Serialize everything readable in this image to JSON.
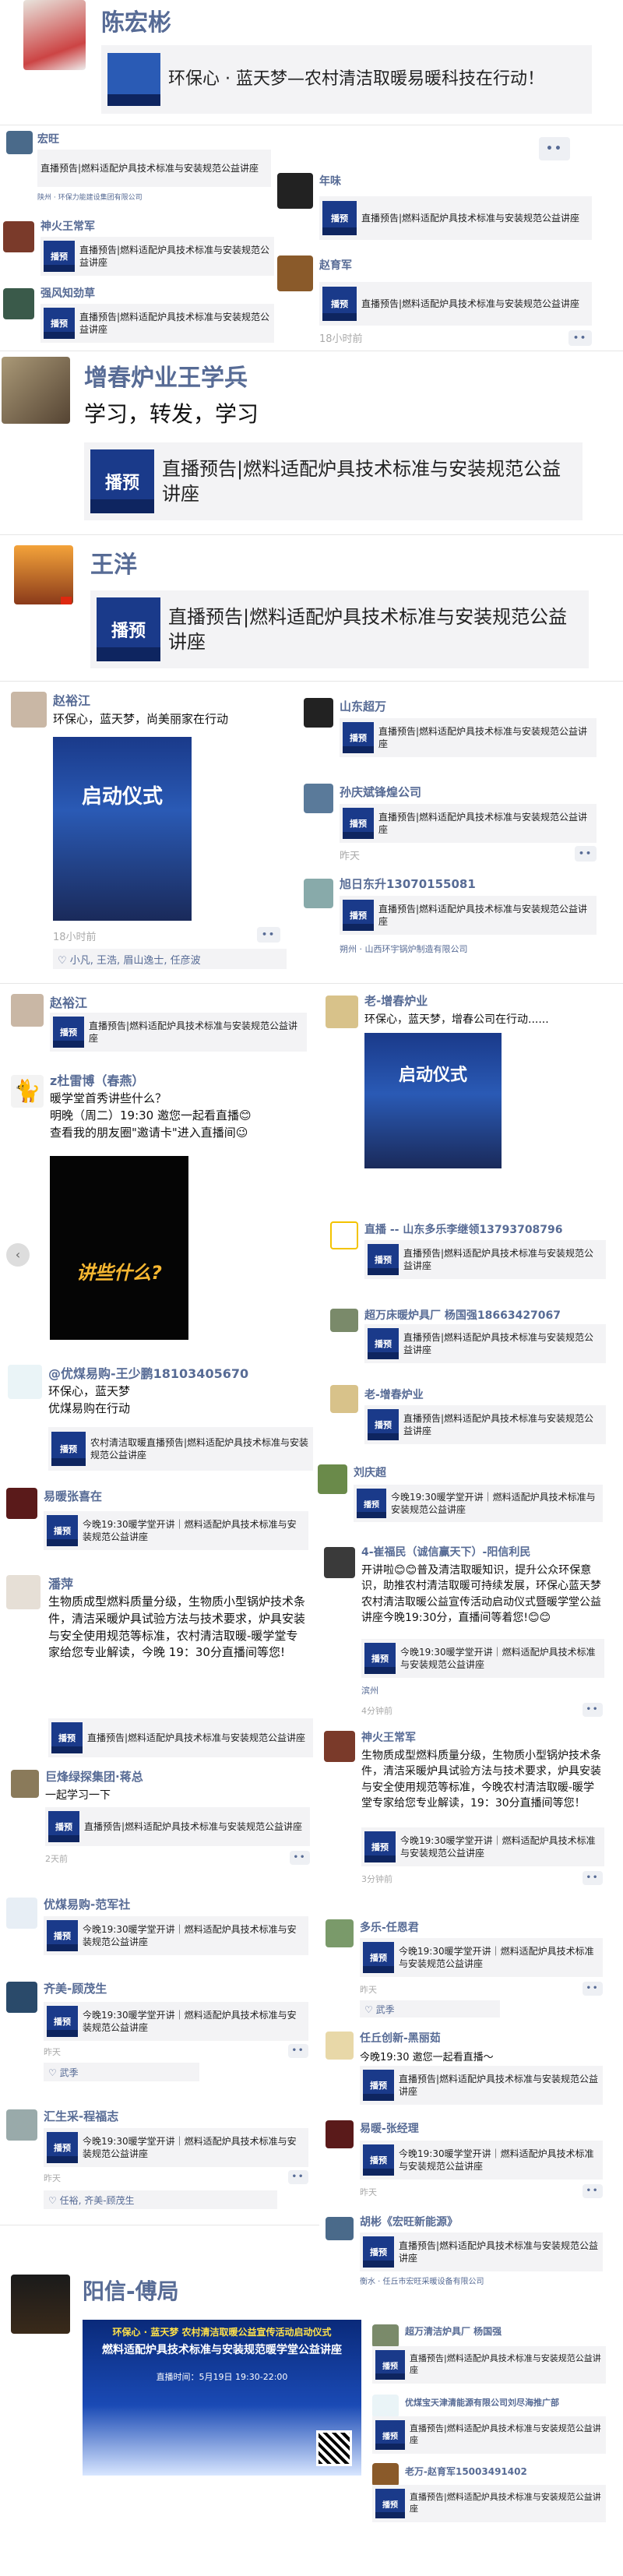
{
  "article_title": "环保心 · 蓝天梦—农村清洁取暖易暖科技在行动！",
  "share_title_a": "直播预告|燃料适配炉具技术标准与安装规范公益讲座",
  "share_title_b": "今晚19:30暖学堂开讲｜燃料适配炉具技术标准与安装规范公益讲座",
  "share_title_c": "农村清洁取暖直播预告|燃料适配炉具技术标准与安装规范公益讲座",
  "thumb_text": "播预",
  "sections": {
    "s1": {
      "name": "陈宏彬"
    },
    "s2": {
      "left_names": [
        "宏旺",
        "神火王常军",
        "强风知劲草"
      ],
      "left_source": "陕州 · 环保力能建设集团有限公司",
      "right_names": [
        "年味",
        "赵育军"
      ],
      "time": "18小时前"
    },
    "s3": {
      "name": "增春炉业王学兵",
      "text": "学习，转发，学习"
    },
    "s4": {
      "name": "王洋"
    },
    "s5": {
      "left_name": "赵裕江",
      "left_text": "环保心，蓝天梦，尚美丽家在行动",
      "poster_text": "启动仪式",
      "left_time": "18小时前",
      "likes": "小凡, 王浩, 眉山逸士, 任彦波",
      "right_names": [
        "山东超万",
        "孙庆斌锋煌公司",
        "旭日东升13070155081"
      ],
      "right_time": "昨天",
      "right_source": "朔州 · 山西环宇锅炉制造有限公司"
    },
    "s6": {
      "left": {
        "name1": "赵裕江",
        "name2": "z杜雷博（春燕）",
        "text2": "暖学堂首秀讲些什么？\n明晚（周二）19:30 邀您一起看直播😊\n查看我的朋友圈\"邀请卡\"进入直播间😉",
        "video_text": "讲些什么?",
        "name3": "@优煤易购-王少鹏18103405670",
        "text3": "环保心，蓝天梦\n优煤易购在行动",
        "name4": "易暖张喜在",
        "name5": "潘萍",
        "text5": "生物质成型燃料质量分级，生物质小型锅炉技术条件，清洁采暖炉具试验方法与技术要求，炉具安装与安全使用规范等标准，农村清洁取暖-暖学堂专家给您专业解读，今晚 19：30分直播间等您!",
        "name6": "巨烽绿探集团·蒋总",
        "text6": "一起学习一下",
        "time6": "2天前",
        "name7": "优煤易购-范军社",
        "name8": "齐美-顾茂生",
        "time8": "昨天",
        "like8": "武季",
        "name9": "汇生采-程福志",
        "time9": "昨天",
        "like9": "任裕, 齐美-顾茂生"
      },
      "right": {
        "name1": "老-增春炉业",
        "text1": "环保心，蓝天梦，增春公司在行动......",
        "name2": "直播 -- 山东多乐李继领13793708796",
        "name3": "超万床暖炉具厂 杨国强18663427067",
        "name4": "老-增春炉业",
        "name5": "刘庆超",
        "name6": "4-崔福民（诚信赢天下）-阳信利民",
        "text6": "开讲啦😊😊普及清洁取暖知识，提升公众环保意识，助推农村清洁取暖可持续发展，环保心蓝天梦农村清洁取暖公益宣传活动启动仪式暨暖学堂公益讲座今晚19:30分，直播间等着您!😊😊",
        "source6": "滨州",
        "time6": "4分钟前",
        "name7": "神火王常军",
        "text7": "生物质成型燃料质量分级，生物质小型锅炉技术条件，清洁采暖炉具试验方法与技术要求，炉具安装与安全使用规范等标准，今晚农村清洁取暖-暖学堂专家给您专业解读，19：30分直播间等您！",
        "time7": "3分钟前",
        "name8": "多乐-任恩君",
        "time8": "昨天",
        "like8": "武季",
        "name9": "任丘创新-黑丽茹",
        "text9": "今晚19:30 邀您一起看直播～",
        "name10": "易暖-张经理",
        "time10": "昨天",
        "name11": "胡彬《宏旺新能源》",
        "source11": "衡水 · 任丘市宏旺采暖设备有限公司"
      }
    },
    "s7": {
      "name": "阳信-傅局",
      "poster_line1": "环保心 · 蓝天梦 农村清洁取暖公益宣传活动启动仪式",
      "poster_line2": "燃料适配炉具技术标准与安装规范暖学堂公益讲座",
      "poster_line3": "直播时间：5月19日 19:30-22:00",
      "right_names": [
        "超万清洁炉具厂 杨国强",
        "优煤宝天津清能源有限公司刘尽海推广部",
        "老万-赵育军15003491402"
      ]
    }
  },
  "colors": {
    "link": "#576b95",
    "thumb": "#1a3a8a",
    "card": "#f3f3f5"
  }
}
